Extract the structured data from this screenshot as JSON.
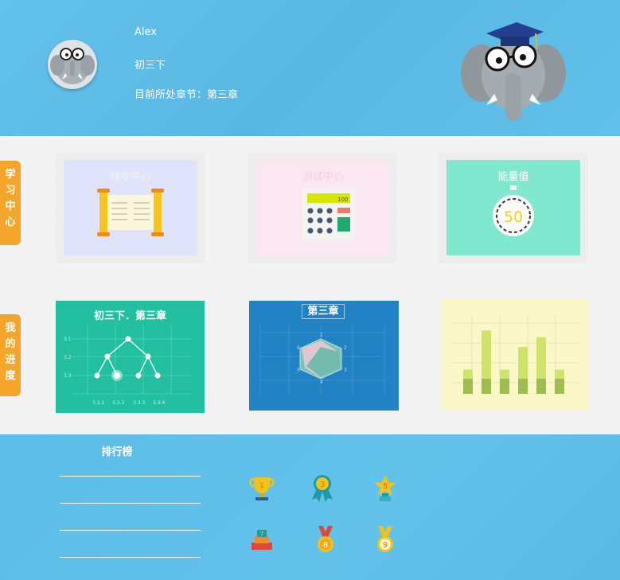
{
  "user": {
    "name": "Alex",
    "grade": "初三下",
    "chapter_label": "目前所处章节：第三章"
  },
  "tabs": {
    "study": [
      "学",
      "习",
      "中",
      "心"
    ],
    "progress": [
      "我",
      "的",
      "进",
      "度"
    ]
  },
  "study_cards": [
    {
      "title": "辅导中心",
      "icon": "scroll-icon",
      "bg": "#dfe3fb"
    },
    {
      "title": "测试中心",
      "icon": "calculator-icon",
      "bg": "#fbe7f2",
      "calc_display": "100"
    },
    {
      "title": "能量值",
      "icon": "stopwatch-icon",
      "bg": "#7fe8cf",
      "value": "50"
    }
  ],
  "progress_panels": {
    "tree": {
      "title": "初三下．第三章",
      "y_labels": [
        "3.1",
        "3.2",
        "3.3"
      ],
      "x_labels": [
        "3.3.1",
        "3.3.2",
        "3.3.3",
        "3.3.4"
      ]
    },
    "radar": {
      "title": "第三章",
      "axis_labels": [
        "1",
        "2",
        "3",
        "4",
        "5",
        "6"
      ]
    },
    "bars": {
      "chart_data": {
        "type": "bar",
        "values_total": [
          32,
          84,
          32,
          62,
          75,
          32
        ],
        "values_base": [
          20,
          20,
          20,
          20,
          20,
          20
        ]
      }
    }
  },
  "leaderboard": {
    "title": "排行榜",
    "entries": [
      "",
      "",
      "",
      ""
    ]
  },
  "badges": [
    {
      "icon": "trophy-icon",
      "label": "1"
    },
    {
      "icon": "ribbon-medal-icon",
      "label": "3"
    },
    {
      "icon": "star-trophy-icon",
      "label": "5"
    },
    {
      "icon": "podium-icon",
      "label": "7"
    },
    {
      "icon": "medal-icon",
      "label": "8"
    },
    {
      "icon": "medal-icon",
      "label": "9"
    }
  ],
  "colors": {
    "header_bg": "#5bbde7",
    "tab_orange": "#f4a52a",
    "tree_panel": "#22c0a0",
    "radar_panel": "#2283c4",
    "bars_panel": "#fbf7c8"
  }
}
